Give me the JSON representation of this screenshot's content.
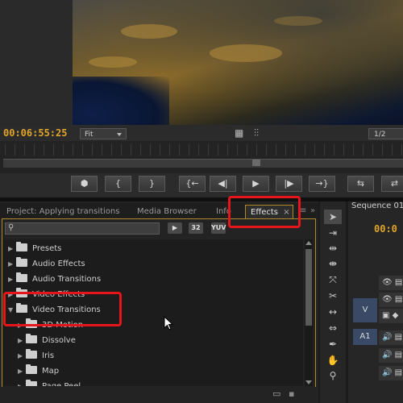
{
  "monitor": {
    "timecode": "00:06:55:25",
    "zoom_select": "Fit",
    "resolution_select": "1/2",
    "buttons": [
      {
        "name": "add-marker-button",
        "glyph": "⬢"
      },
      {
        "name": "mark-in-button",
        "glyph": "{"
      },
      {
        "name": "mark-out-button",
        "glyph": "}"
      },
      {
        "name": "go-to-in-button",
        "glyph": "{←"
      },
      {
        "name": "step-back-button",
        "glyph": "◀|"
      },
      {
        "name": "play-button",
        "glyph": "▶"
      },
      {
        "name": "step-forward-button",
        "glyph": "|▶"
      },
      {
        "name": "go-to-out-button",
        "glyph": "→}"
      },
      {
        "name": "insert-button",
        "glyph": "⇆"
      },
      {
        "name": "overwrite-button",
        "glyph": "⇄"
      }
    ]
  },
  "tabs": {
    "project": "Project: Applying transitions",
    "media_browser": "Media Browser",
    "info": "Info",
    "effects": "Effects",
    "effects_close": "×"
  },
  "effects_panel": {
    "search_value": "",
    "badges": [
      "32",
      "YUV"
    ],
    "items": [
      {
        "label": "Presets",
        "indent": 0,
        "expanded": false
      },
      {
        "label": "Audio Effects",
        "indent": 0,
        "expanded": false
      },
      {
        "label": "Audio Transitions",
        "indent": 0,
        "expanded": false
      },
      {
        "label": "Video Effects",
        "indent": 0,
        "expanded": false
      },
      {
        "label": "Video Transitions",
        "indent": 0,
        "expanded": true
      },
      {
        "label": "3D Motion",
        "indent": 1,
        "expanded": false
      },
      {
        "label": "Dissolve",
        "indent": 1,
        "expanded": false
      },
      {
        "label": "Iris",
        "indent": 1,
        "expanded": false
      },
      {
        "label": "Map",
        "indent": 1,
        "expanded": false
      },
      {
        "label": "Page Peel",
        "indent": 1,
        "expanded": false
      }
    ]
  },
  "sequence": {
    "tab": "Sequence 01",
    "timecode": "00:0",
    "tracks": [
      "V",
      "A1"
    ]
  },
  "colors": {
    "accent_timecode": "#e2a52a",
    "highlight": "#e5161a",
    "panel_border": "#b08a2a"
  }
}
